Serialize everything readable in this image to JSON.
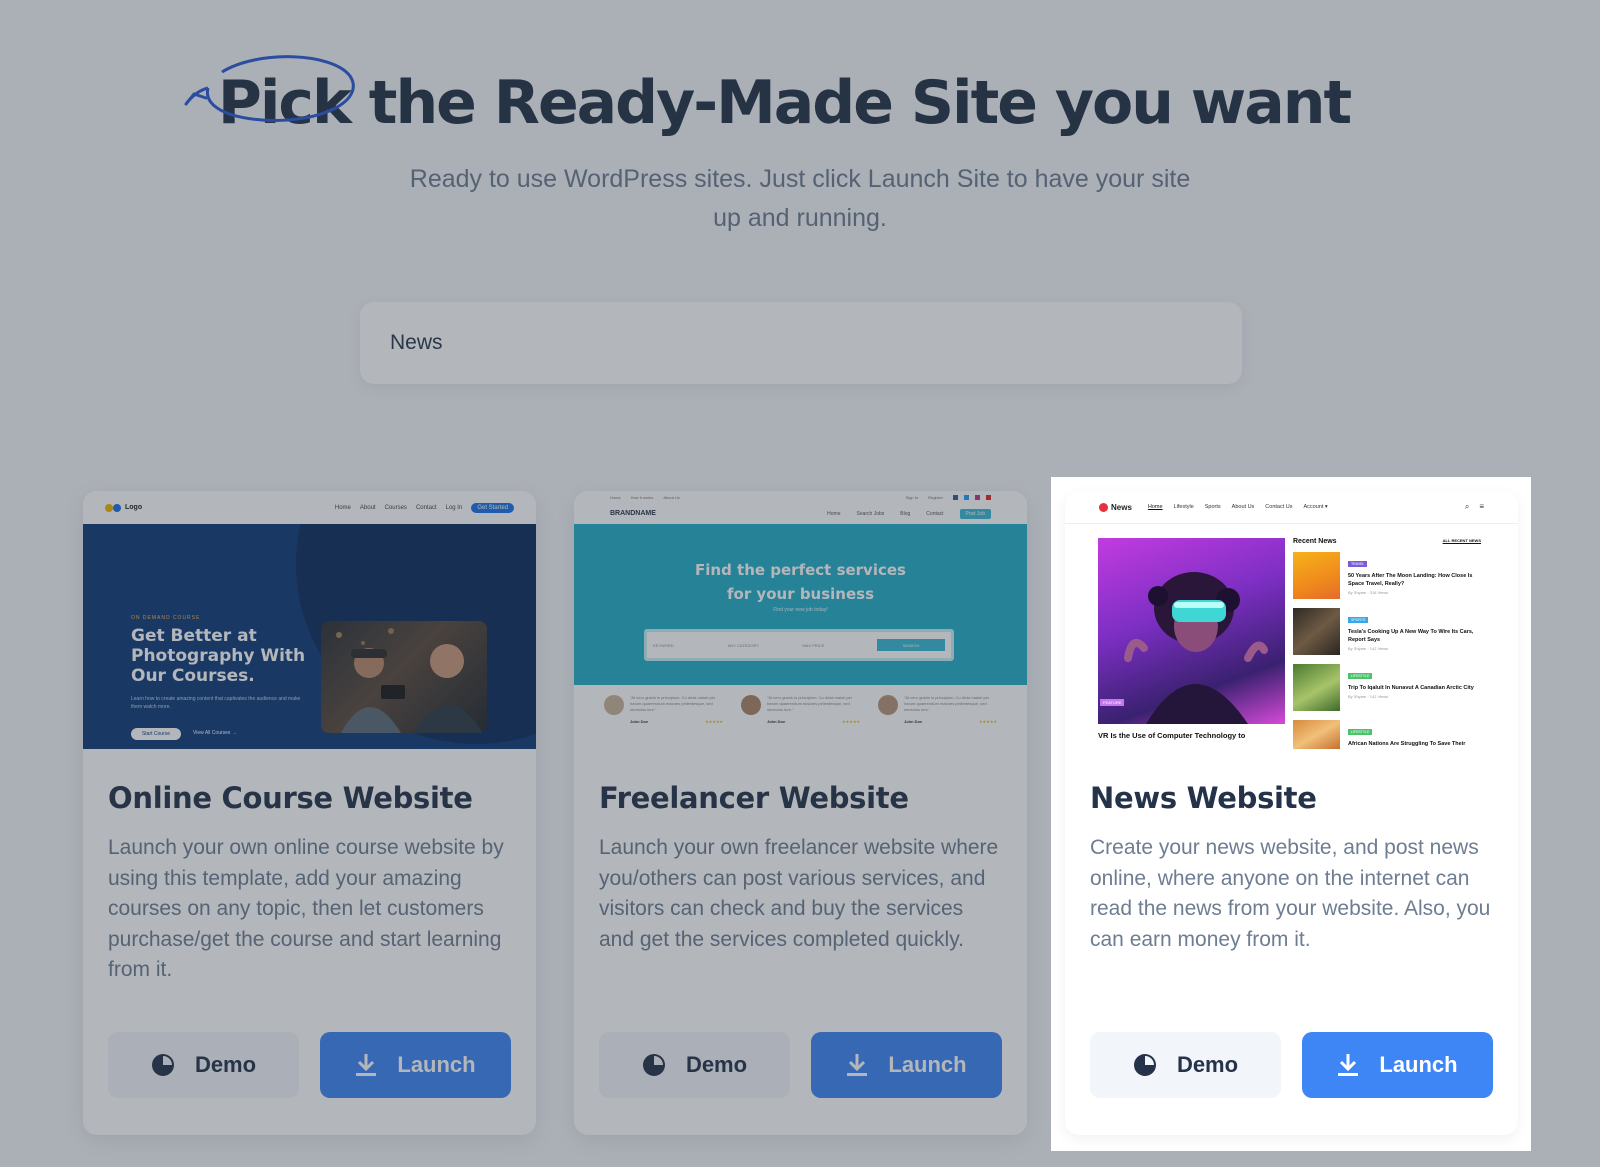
{
  "hero": {
    "title_pick": "Pick",
    "title_rest": " the Ready-Made Site you want",
    "subtitle": "Ready to use WordPress sites. Just click Launch Site to have your site up and running."
  },
  "search": {
    "value": "News"
  },
  "colors": {
    "launch_button": "#3e86f5",
    "title": "#233249",
    "annotation_circle": "#2b5bd6"
  },
  "cards": [
    {
      "title": "Online Course Website",
      "description": "Launch your own online course website by using this template, add your amazing courses on any topic, then let customers purchase/get the course and start learning from it.",
      "demo_label": "Demo",
      "launch_label": "Launch",
      "preview": {
        "logo": "Logo",
        "nav": [
          "Home",
          "About",
          "Courses",
          "Contact",
          "Log In"
        ],
        "nav_cta": "Get Started",
        "kicker": "ON DEMAND COURSE",
        "headline": "Get Better at Photography With Our Courses.",
        "blurb": "Learn how to create amazing content that captivates the audience and make them watch more.",
        "primary_btn": "Start Course",
        "secondary_link": "View All Courses →"
      }
    },
    {
      "title": "Freelancer Website",
      "description": "Launch your own freelancer website where you/others can post various services, and visitors can check and buy the services and get the services completed quickly.",
      "demo_label": "Demo",
      "launch_label": "Launch",
      "preview": {
        "topbar": [
          "Home",
          "How it works",
          "About Us",
          "Sign In",
          "Register"
        ],
        "brand": "BRANDNAME",
        "nav": [
          "Home",
          "Search Jobs",
          "Blog",
          "Contact"
        ],
        "nav_cta": "Post Job",
        "headline_1": "Find the perfect services",
        "headline_2": "for your business",
        "sub": "Find your new job today!",
        "search_fields": [
          "KEYWORD",
          "ANY CATEGORY",
          "MAX PRICE"
        ],
        "search_btn": "SEARCH",
        "reviewer": "John Doe",
        "review_text": "\"At vero gravis in principium. Cu dicta maiori per harum quaerendum maiores pellentesque, sed senectus iure.\"",
        "stars": "★★★★★"
      }
    },
    {
      "title": "News Website",
      "description": "Create your news website, and post news online, where anyone on the internet can read the news from your website. Also, you can earn money from it.",
      "demo_label": "Demo",
      "launch_label": "Launch",
      "preview": {
        "logo": "News",
        "nav": [
          "Home",
          "Lifestyle",
          "Sports",
          "About Us",
          "Contact Us",
          "Account ▾"
        ],
        "feature_tag": "FEATURE",
        "feature_title": "VR Is the Use of Computer Technology to",
        "recent_heading": "Recent News",
        "recent_all": "ALL RECENT NEWS",
        "items": [
          {
            "tag": "TRAVEL",
            "tag_color": "#7b5bd6",
            "title": "50 Years After The Moon Landing: How Close Is Space Travel, Really?",
            "meta": "By Shyam  ·  318 Views"
          },
          {
            "tag": "SPORTS",
            "tag_color": "#3aa8e8",
            "title": "Tesla's Cooking Up A New Way To Wire Its Cars, Report Says",
            "meta": "By Shyam  ·  142 Views"
          },
          {
            "tag": "LIFESTYLE",
            "tag_color": "#4cc46a",
            "title": "Trip To Iqaluit In Nunavut A Canadian Arctic City",
            "meta": "By Shyam  ·  142 Views"
          },
          {
            "tag": "LIFESTYLE",
            "tag_color": "#4cc46a",
            "title": "African Nations Are Struggling To Save Their Wildlife",
            "meta": ""
          }
        ]
      }
    }
  ]
}
